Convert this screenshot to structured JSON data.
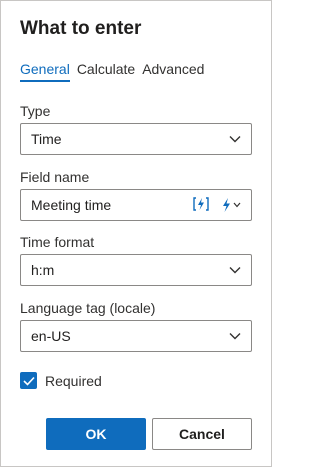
{
  "dialog": {
    "title": "What to enter"
  },
  "tabs": [
    {
      "label": "General",
      "active": true
    },
    {
      "label": "Calculate",
      "active": false
    },
    {
      "label": "Advanced",
      "active": false
    }
  ],
  "fields": {
    "type": {
      "label": "Type",
      "value": "Time",
      "icon": "chevron-down-icon"
    },
    "field_name": {
      "label": "Field name",
      "value": "Meeting time",
      "icons": [
        "dynamic-content-icon",
        "lightning-dropdown-icon"
      ]
    },
    "time_format": {
      "label": "Time format",
      "value": "h:m",
      "icon": "chevron-down-icon"
    },
    "language_tag": {
      "label": "Language tag (locale)",
      "value": "en-US",
      "icon": "chevron-down-icon"
    }
  },
  "required": {
    "label": "Required",
    "checked": true
  },
  "buttons": {
    "ok": "OK",
    "cancel": "Cancel"
  },
  "colors": {
    "accent": "#0f6cbd",
    "border": "#8a8886"
  }
}
